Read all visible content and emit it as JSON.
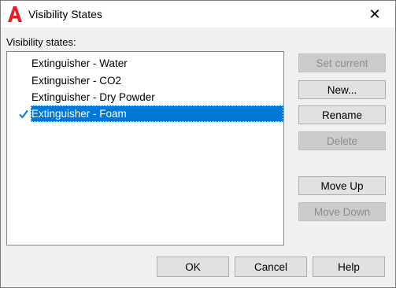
{
  "window": {
    "title": "Visibility States",
    "close_label": "✕"
  },
  "list": {
    "label": "Visibility states:",
    "items": [
      {
        "label": "Extinguisher - Water",
        "selected": false,
        "checked": false
      },
      {
        "label": "Extinguisher - CO2",
        "selected": false,
        "checked": false
      },
      {
        "label": "Extinguisher - Dry Powder",
        "selected": false,
        "checked": false
      },
      {
        "label": "Extinguisher - Foam",
        "selected": true,
        "checked": true
      }
    ]
  },
  "side_buttons": {
    "set_current": "Set current",
    "new": "New...",
    "rename": "Rename",
    "delete": "Delete",
    "move_up": "Move Up",
    "move_down": "Move Down"
  },
  "bottom_buttons": {
    "ok": "OK",
    "cancel": "Cancel",
    "help": "Help"
  },
  "icons": {
    "app": "autocad-logo-icon",
    "check": "checkmark-icon",
    "close": "close-icon"
  },
  "colors": {
    "accent": "#0078d7",
    "app_icon": "#e51e25"
  }
}
